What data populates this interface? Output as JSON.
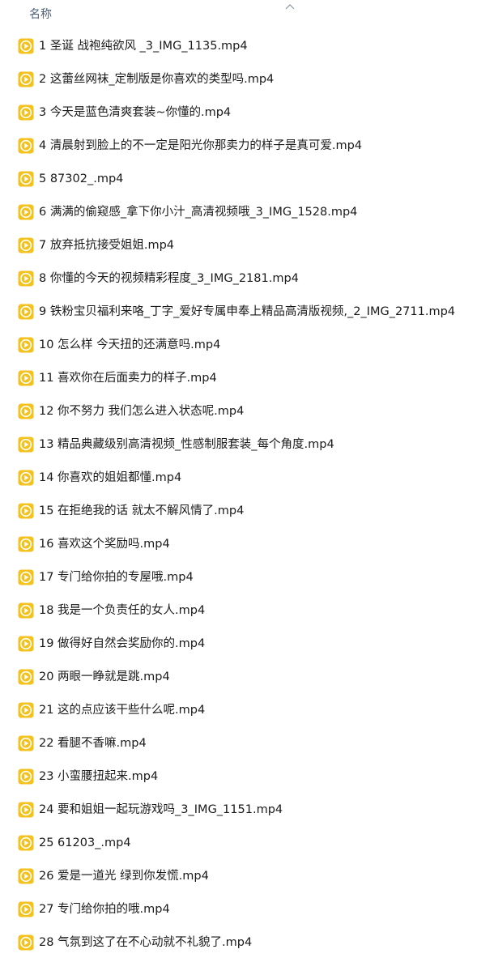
{
  "header": {
    "column_name": "名称"
  },
  "icons": {
    "file": "video-file-icon",
    "accent": "#f4c21d",
    "play": "#ffffff"
  },
  "files": [
    {
      "name": "1 圣诞 战袍纯欲风  _3_IMG_1135.mp4"
    },
    {
      "name": "2 这蕾丝网袜_定制版是你喜欢的类型吗.mp4"
    },
    {
      "name": "3 今天是蓝色清爽套装~你懂的.mp4"
    },
    {
      "name": "4 清晨射到脸上的不一定是阳光你那卖力的样子是真可爱.mp4"
    },
    {
      "name": "5 87302_.mp4"
    },
    {
      "name": "6 满满的偷窥感_拿下你小汁_高清视频哦_3_IMG_1528.mp4"
    },
    {
      "name": "7 放弃抵抗接受姐姐.mp4"
    },
    {
      "name": "8 你懂的今天的视频精彩程度_3_IMG_2181.mp4"
    },
    {
      "name": "9 铁粉宝贝福利来咯_丁字_爱好专属申奉上精品高清版视频,_2_IMG_2711.mp4"
    },
    {
      "name": "10 怎么样 今天扭的还满意吗.mp4"
    },
    {
      "name": "11 喜欢你在后面卖力的样子.mp4"
    },
    {
      "name": "12 你不努力 我们怎么进入状态呢.mp4"
    },
    {
      "name": "13 精品典藏级别高清视频_性感制服套装_每个角度.mp4"
    },
    {
      "name": "14 你喜欢的姐姐都懂.mp4"
    },
    {
      "name": "15 在拒绝我的话 就太不解风情了.mp4"
    },
    {
      "name": "16 喜欢这个奖励吗.mp4"
    },
    {
      "name": "17 专门给你拍的专屋哦.mp4"
    },
    {
      "name": "18 我是一个负责任的女人.mp4"
    },
    {
      "name": "19 做得好自然会奖励你的.mp4"
    },
    {
      "name": "20 两眼一睁就是跳.mp4"
    },
    {
      "name": "21 这的点应该干些什么呢.mp4"
    },
    {
      "name": "22 看腿不香嘛.mp4"
    },
    {
      "name": "23 小蛮腰扭起来.mp4"
    },
    {
      "name": "24 要和姐姐一起玩游戏吗_3_IMG_1151.mp4"
    },
    {
      "name": "25 61203_.mp4"
    },
    {
      "name": "26 爱是一道光 绿到你发慌.mp4"
    },
    {
      "name": "27 专门给你拍的哦.mp4"
    },
    {
      "name": "28 气氛到这了在不心动就不礼貌了.mp4"
    }
  ]
}
